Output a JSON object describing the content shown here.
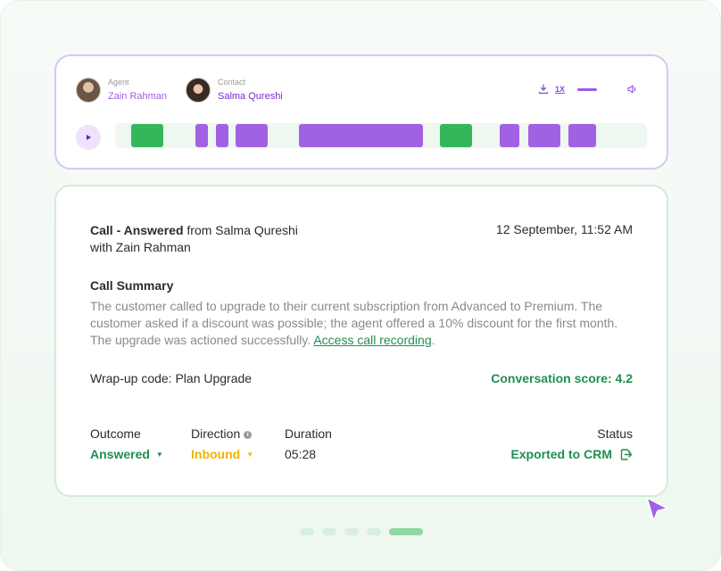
{
  "player": {
    "agent": {
      "role": "Agent",
      "name": "Zain Rahman"
    },
    "contact": {
      "role": "Contact",
      "name": "Salma Qureshi"
    },
    "speed": "1X",
    "volume_level": 0.6,
    "segments_color": {
      "agent": "#34b75a",
      "contact": "#a062e3"
    }
  },
  "call": {
    "title_bold": "Call - Answered",
    "title_rest": " from Salma Qureshi",
    "title_line2": "with Zain Rahman",
    "datetime": "12 September, 11:52 AM",
    "summary_heading": "Call Summary",
    "summary_text": "The customer called to upgrade to their current subscription from Advanced to Premium. The customer asked if a discount was possible; the agent offered a 10% discount for the first month. The upgrade was actioned successfully. ",
    "recording_link": "Access call recording",
    "summary_end": ".",
    "wrapup": "Wrap-up code: Plan Upgrade",
    "score": "Conversation score: 4.2",
    "outcome_label": "Outcome",
    "outcome_value": "Answered",
    "direction_label": "Direction",
    "direction_value": "Inbound",
    "duration_label": "Duration",
    "duration_value": "05:28",
    "status_label": "Status",
    "status_value": "Exported to CRM"
  },
  "pager": {
    "count": 5,
    "active": 5
  },
  "colors": {
    "accent_green": "#1f8f50",
    "accent_purple": "#9c5fe0",
    "amber": "#f0b400"
  }
}
